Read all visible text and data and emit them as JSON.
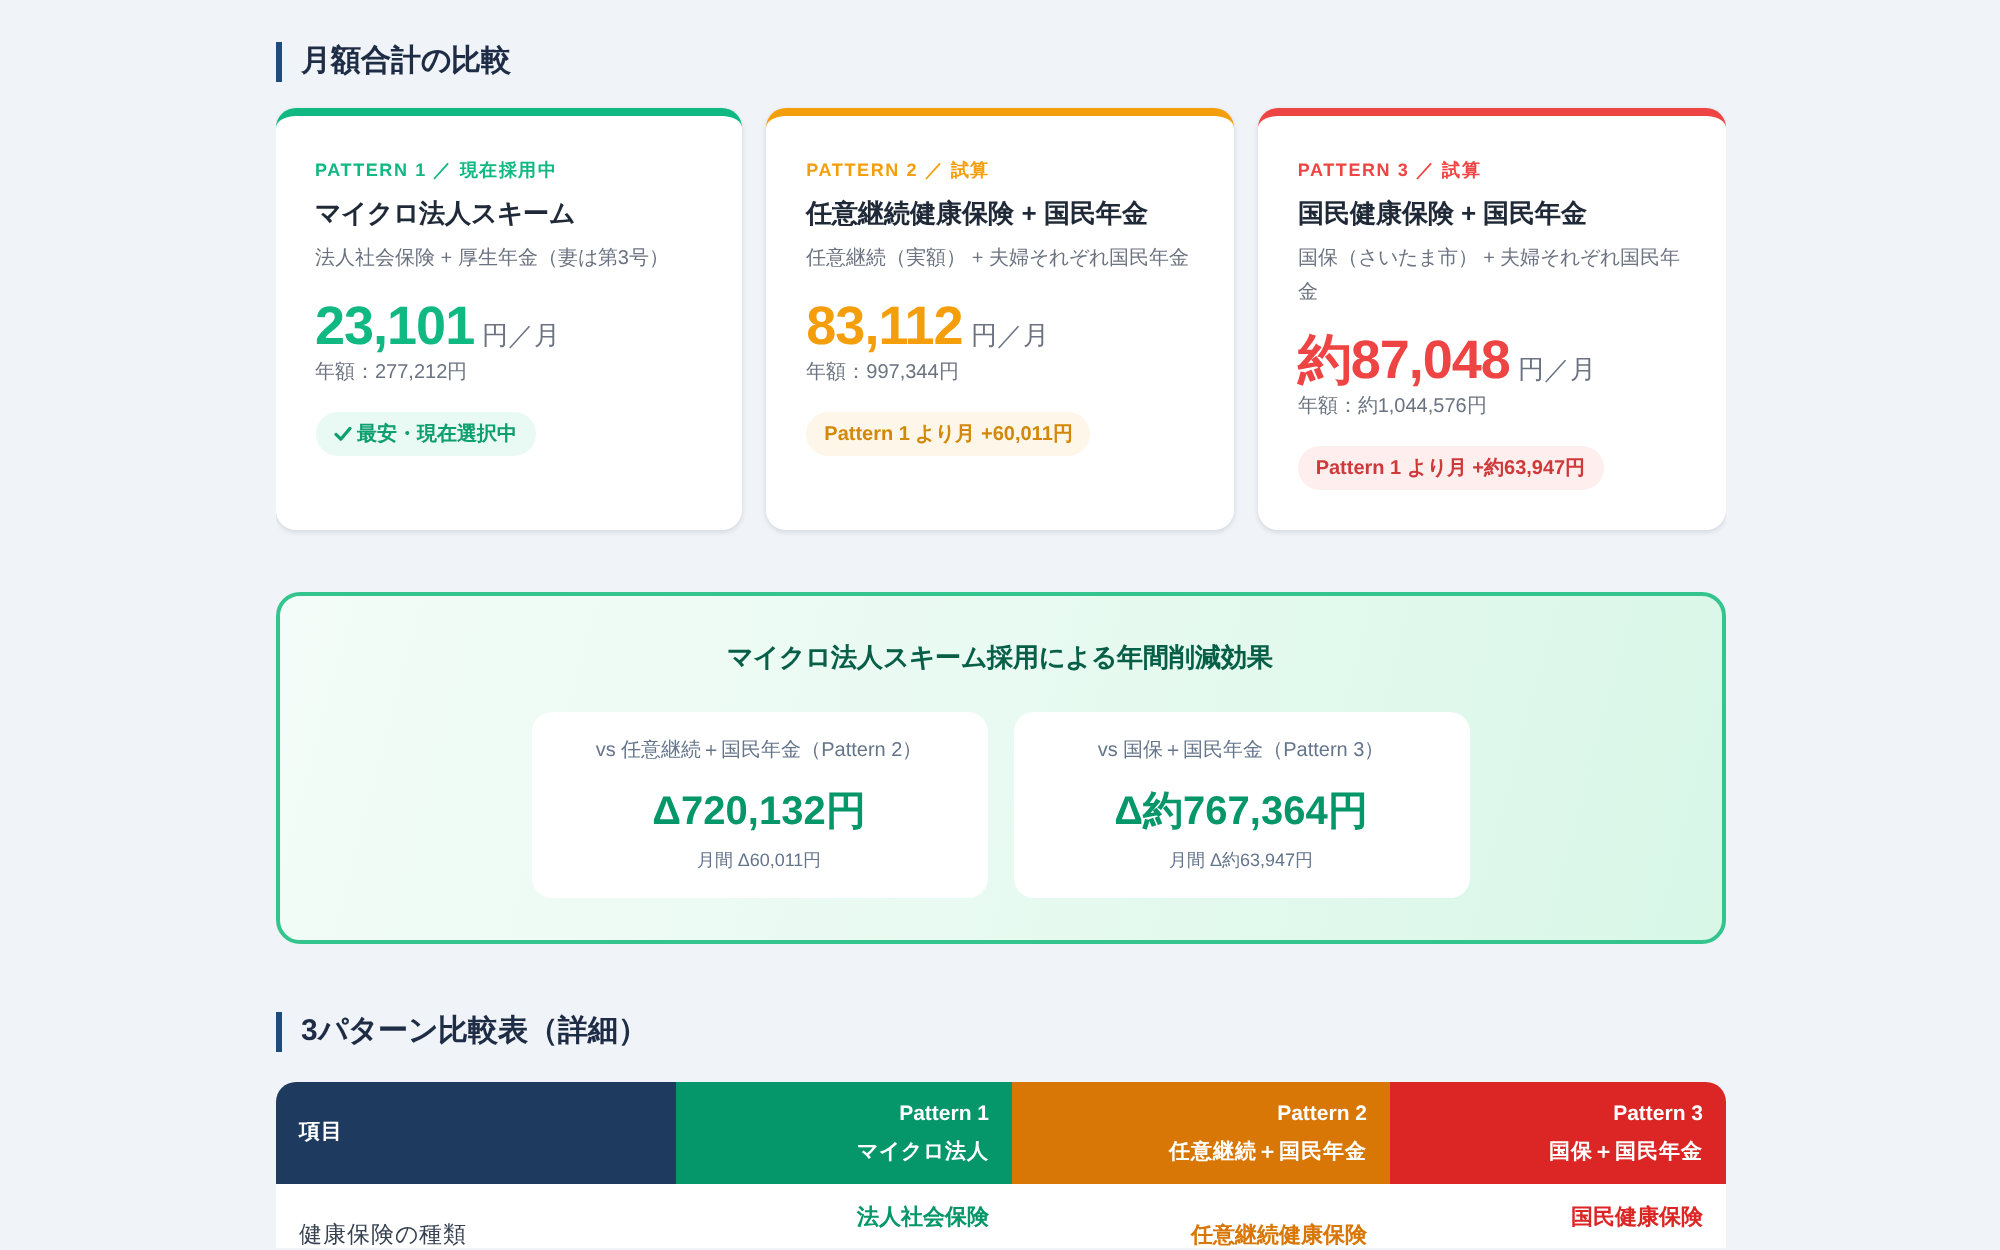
{
  "monthly_comparison": {
    "title": "月額合計の比較",
    "cards": [
      {
        "label": "PATTERN 1 ／ 現在採用中",
        "title": "マイクロ法人スキーム",
        "description": "法人社会保険 + 厚生年金（妻は第3号）",
        "amount": "23,101",
        "unit": "円／月",
        "annual": "年額：277,212円",
        "color": "#10b981",
        "badge": {
          "kind": "best",
          "text": "最安・現在選択中"
        }
      },
      {
        "label": "PATTERN 2 ／ 試算",
        "title": "任意継続健康保険 + 国民年金",
        "description": "任意継続（実額） + 夫婦それぞれ国民年金",
        "amount": "83,112",
        "unit": "円／月",
        "annual": "年額：997,344円",
        "color": "#f59e0b",
        "badge": {
          "kind": "difference",
          "text": "Pattern 1 より月 +60,011円"
        }
      },
      {
        "label": "PATTERN 3 ／ 試算",
        "title": "国民健康保険 + 国民年金",
        "description": "国保（さいたま市） + 夫婦それぞれ国民年金",
        "amount": "約87,048",
        "unit": "円／月",
        "annual": "年額：約1,044,576円",
        "color": "#ef4444",
        "badge": {
          "kind": "difference",
          "text": "Pattern 1 より月 +約63,947円"
        }
      }
    ]
  },
  "annual_savings": {
    "title": "マイクロ法人スキーム採用による年間削減効果",
    "items": [
      {
        "label": "vs 任意継続＋国民年金（Pattern 2）",
        "amount": "Δ720,132円",
        "monthly": "月間 Δ60,011円"
      },
      {
        "label": "vs 国保＋国民年金（Pattern 3）",
        "amount": "Δ約767,364円",
        "monthly": "月間 Δ約63,947円"
      }
    ]
  },
  "comparison_table": {
    "title": "3パターン比較表（詳細）",
    "columns": [
      {
        "label": "項目",
        "color": "#1e3a5f"
      },
      {
        "label": "Pattern 1",
        "sublabel": "マイクロ法人",
        "color": "#059669"
      },
      {
        "label": "Pattern 2",
        "sublabel": "任意継続＋国民年金",
        "color": "#d97706"
      },
      {
        "label": "Pattern 3",
        "sublabel": "国保＋国民年金",
        "color": "#dc2626"
      }
    ],
    "rows": [
      {
        "label": "健康保険の種類",
        "values": [
          "法人社会保険",
          "任意継続健康保険",
          "国民健康保険"
        ]
      }
    ]
  }
}
